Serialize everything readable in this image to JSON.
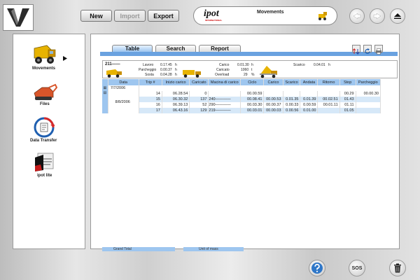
{
  "app": {
    "logo": "V"
  },
  "toolbar": {
    "new_label": "New",
    "import_label": "Import",
    "export_label": "Export"
  },
  "banner": {
    "brand": "ipot",
    "brand_sub": "INTERNATIONAL",
    "title": "Movements"
  },
  "nav_icons": [
    "back-icon",
    "forward-icon",
    "eject-icon"
  ],
  "sidebar": {
    "items": [
      {
        "label": "Movements",
        "icon": "loader-truck-icon"
      },
      {
        "label": "Files",
        "icon": "excavator-icon"
      },
      {
        "label": "Data Transfer",
        "icon": "data-transfer-icon"
      },
      {
        "label": "ipot lite",
        "icon": "ipot-lite-icon"
      }
    ]
  },
  "tabs": [
    {
      "label": "Table"
    },
    {
      "label": "Search"
    },
    {
      "label": "Report"
    }
  ],
  "summary": {
    "id": "211——",
    "lavoro_label": "Lavoro",
    "lavoro_value": "0.17.45",
    "lavoro_unit": "h",
    "parcheggio_label": "Parcheggio",
    "parcheggio_value": "0.00.37",
    "parcheggio_unit": "h",
    "sosta_label": "Sosta",
    "sosta_value": "0.04.28",
    "sosta_unit": "h",
    "carico_label": "Carico",
    "carico_value": "0.01.30",
    "carico_unit": "h",
    "caricato_label": "Caricato",
    "caricato_value": "1060",
    "caricato_unit": "t",
    "overload_label": "Overload",
    "overload_value": "29",
    "overload_unit": "%",
    "scarico_label": "Scarico",
    "scarico_value": "0.04.01",
    "scarico_unit": "h"
  },
  "table": {
    "columns": [
      "Data",
      "Trip #",
      "Inizio carico",
      "Caricato",
      "Macina di carico",
      "Ciclo",
      "Carico",
      "Scarico",
      "Andata",
      "Ritorno",
      "Stop",
      "Parcheggio"
    ],
    "group1": {
      "expander": "⊞",
      "date": "7/7/2006"
    },
    "group2": {
      "expander": "⊟",
      "date": "8/8/2006"
    },
    "rows": [
      {
        "trip": "14",
        "inizio": "06.28.54",
        "caricato": "0",
        "macina": "",
        "ciclo": "00.00.59",
        "carico": "",
        "scarico": "",
        "andata": "",
        "ritorno": "",
        "stop": "00.29",
        "parcheggio": "00.00.30"
      },
      {
        "trip": "15",
        "inizio": "06.30.32",
        "caricato": "137",
        "macina": "240————",
        "ciclo": "00.08.41",
        "carico": "00.00.53",
        "scarico": "0.01.35",
        "andata": "0.01.39",
        "ritorno": "00.02.51",
        "stop": "01.43",
        "parcheggio": ""
      },
      {
        "trip": "16",
        "inizio": "06.39.13",
        "caricato": "52",
        "macina": "290————",
        "ciclo": "00.03.30",
        "carico": "00.00.37",
        "scarico": "0.00.33",
        "andata": "0.00.59",
        "ritorno": "00.01.11",
        "stop": "01.11",
        "parcheggio": ""
      },
      {
        "trip": "17",
        "inizio": "06.43.16",
        "caricato": "129",
        "macina": "219————",
        "ciclo": "00.03.01",
        "carico": "00.00.03",
        "scarico": "0.00.56",
        "andata": "0.01.00",
        "ritorno": "",
        "stop": "01.05",
        "parcheggio": ""
      }
    ]
  },
  "footer": {
    "grand_total": "Grand Total",
    "unit_of_mass": "Unit of mass"
  },
  "bottom": {
    "sos_label": "SOS",
    "help_icon": "help-icon",
    "trash_icon": "trash-icon"
  }
}
